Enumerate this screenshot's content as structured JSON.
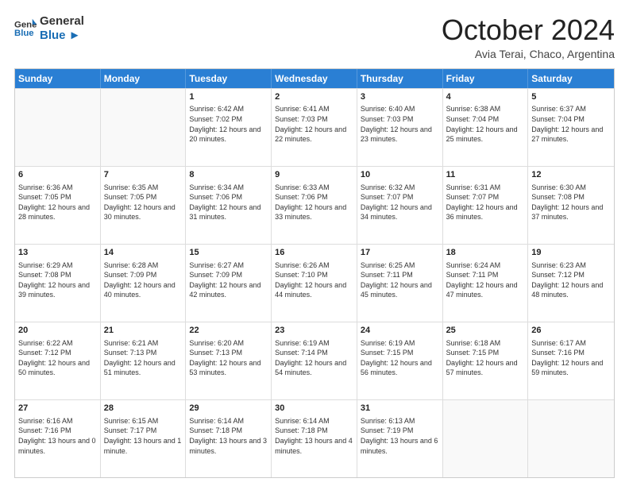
{
  "logo": {
    "general": "General",
    "blue": "Blue"
  },
  "header": {
    "month": "October 2024",
    "location": "Avia Terai, Chaco, Argentina"
  },
  "weekdays": [
    "Sunday",
    "Monday",
    "Tuesday",
    "Wednesday",
    "Thursday",
    "Friday",
    "Saturday"
  ],
  "weeks": [
    [
      {
        "day": "",
        "sunrise": "",
        "sunset": "",
        "daylight": ""
      },
      {
        "day": "",
        "sunrise": "",
        "sunset": "",
        "daylight": ""
      },
      {
        "day": "1",
        "sunrise": "Sunrise: 6:42 AM",
        "sunset": "Sunset: 7:02 PM",
        "daylight": "Daylight: 12 hours and 20 minutes."
      },
      {
        "day": "2",
        "sunrise": "Sunrise: 6:41 AM",
        "sunset": "Sunset: 7:03 PM",
        "daylight": "Daylight: 12 hours and 22 minutes."
      },
      {
        "day": "3",
        "sunrise": "Sunrise: 6:40 AM",
        "sunset": "Sunset: 7:03 PM",
        "daylight": "Daylight: 12 hours and 23 minutes."
      },
      {
        "day": "4",
        "sunrise": "Sunrise: 6:38 AM",
        "sunset": "Sunset: 7:04 PM",
        "daylight": "Daylight: 12 hours and 25 minutes."
      },
      {
        "day": "5",
        "sunrise": "Sunrise: 6:37 AM",
        "sunset": "Sunset: 7:04 PM",
        "daylight": "Daylight: 12 hours and 27 minutes."
      }
    ],
    [
      {
        "day": "6",
        "sunrise": "Sunrise: 6:36 AM",
        "sunset": "Sunset: 7:05 PM",
        "daylight": "Daylight: 12 hours and 28 minutes."
      },
      {
        "day": "7",
        "sunrise": "Sunrise: 6:35 AM",
        "sunset": "Sunset: 7:05 PM",
        "daylight": "Daylight: 12 hours and 30 minutes."
      },
      {
        "day": "8",
        "sunrise": "Sunrise: 6:34 AM",
        "sunset": "Sunset: 7:06 PM",
        "daylight": "Daylight: 12 hours and 31 minutes."
      },
      {
        "day": "9",
        "sunrise": "Sunrise: 6:33 AM",
        "sunset": "Sunset: 7:06 PM",
        "daylight": "Daylight: 12 hours and 33 minutes."
      },
      {
        "day": "10",
        "sunrise": "Sunrise: 6:32 AM",
        "sunset": "Sunset: 7:07 PM",
        "daylight": "Daylight: 12 hours and 34 minutes."
      },
      {
        "day": "11",
        "sunrise": "Sunrise: 6:31 AM",
        "sunset": "Sunset: 7:07 PM",
        "daylight": "Daylight: 12 hours and 36 minutes."
      },
      {
        "day": "12",
        "sunrise": "Sunrise: 6:30 AM",
        "sunset": "Sunset: 7:08 PM",
        "daylight": "Daylight: 12 hours and 37 minutes."
      }
    ],
    [
      {
        "day": "13",
        "sunrise": "Sunrise: 6:29 AM",
        "sunset": "Sunset: 7:08 PM",
        "daylight": "Daylight: 12 hours and 39 minutes."
      },
      {
        "day": "14",
        "sunrise": "Sunrise: 6:28 AM",
        "sunset": "Sunset: 7:09 PM",
        "daylight": "Daylight: 12 hours and 40 minutes."
      },
      {
        "day": "15",
        "sunrise": "Sunrise: 6:27 AM",
        "sunset": "Sunset: 7:09 PM",
        "daylight": "Daylight: 12 hours and 42 minutes."
      },
      {
        "day": "16",
        "sunrise": "Sunrise: 6:26 AM",
        "sunset": "Sunset: 7:10 PM",
        "daylight": "Daylight: 12 hours and 44 minutes."
      },
      {
        "day": "17",
        "sunrise": "Sunrise: 6:25 AM",
        "sunset": "Sunset: 7:11 PM",
        "daylight": "Daylight: 12 hours and 45 minutes."
      },
      {
        "day": "18",
        "sunrise": "Sunrise: 6:24 AM",
        "sunset": "Sunset: 7:11 PM",
        "daylight": "Daylight: 12 hours and 47 minutes."
      },
      {
        "day": "19",
        "sunrise": "Sunrise: 6:23 AM",
        "sunset": "Sunset: 7:12 PM",
        "daylight": "Daylight: 12 hours and 48 minutes."
      }
    ],
    [
      {
        "day": "20",
        "sunrise": "Sunrise: 6:22 AM",
        "sunset": "Sunset: 7:12 PM",
        "daylight": "Daylight: 12 hours and 50 minutes."
      },
      {
        "day": "21",
        "sunrise": "Sunrise: 6:21 AM",
        "sunset": "Sunset: 7:13 PM",
        "daylight": "Daylight: 12 hours and 51 minutes."
      },
      {
        "day": "22",
        "sunrise": "Sunrise: 6:20 AM",
        "sunset": "Sunset: 7:13 PM",
        "daylight": "Daylight: 12 hours and 53 minutes."
      },
      {
        "day": "23",
        "sunrise": "Sunrise: 6:19 AM",
        "sunset": "Sunset: 7:14 PM",
        "daylight": "Daylight: 12 hours and 54 minutes."
      },
      {
        "day": "24",
        "sunrise": "Sunrise: 6:19 AM",
        "sunset": "Sunset: 7:15 PM",
        "daylight": "Daylight: 12 hours and 56 minutes."
      },
      {
        "day": "25",
        "sunrise": "Sunrise: 6:18 AM",
        "sunset": "Sunset: 7:15 PM",
        "daylight": "Daylight: 12 hours and 57 minutes."
      },
      {
        "day": "26",
        "sunrise": "Sunrise: 6:17 AM",
        "sunset": "Sunset: 7:16 PM",
        "daylight": "Daylight: 12 hours and 59 minutes."
      }
    ],
    [
      {
        "day": "27",
        "sunrise": "Sunrise: 6:16 AM",
        "sunset": "Sunset: 7:16 PM",
        "daylight": "Daylight: 13 hours and 0 minutes."
      },
      {
        "day": "28",
        "sunrise": "Sunrise: 6:15 AM",
        "sunset": "Sunset: 7:17 PM",
        "daylight": "Daylight: 13 hours and 1 minute."
      },
      {
        "day": "29",
        "sunrise": "Sunrise: 6:14 AM",
        "sunset": "Sunset: 7:18 PM",
        "daylight": "Daylight: 13 hours and 3 minutes."
      },
      {
        "day": "30",
        "sunrise": "Sunrise: 6:14 AM",
        "sunset": "Sunset: 7:18 PM",
        "daylight": "Daylight: 13 hours and 4 minutes."
      },
      {
        "day": "31",
        "sunrise": "Sunrise: 6:13 AM",
        "sunset": "Sunset: 7:19 PM",
        "daylight": "Daylight: 13 hours and 6 minutes."
      },
      {
        "day": "",
        "sunrise": "",
        "sunset": "",
        "daylight": ""
      },
      {
        "day": "",
        "sunrise": "",
        "sunset": "",
        "daylight": ""
      }
    ]
  ]
}
